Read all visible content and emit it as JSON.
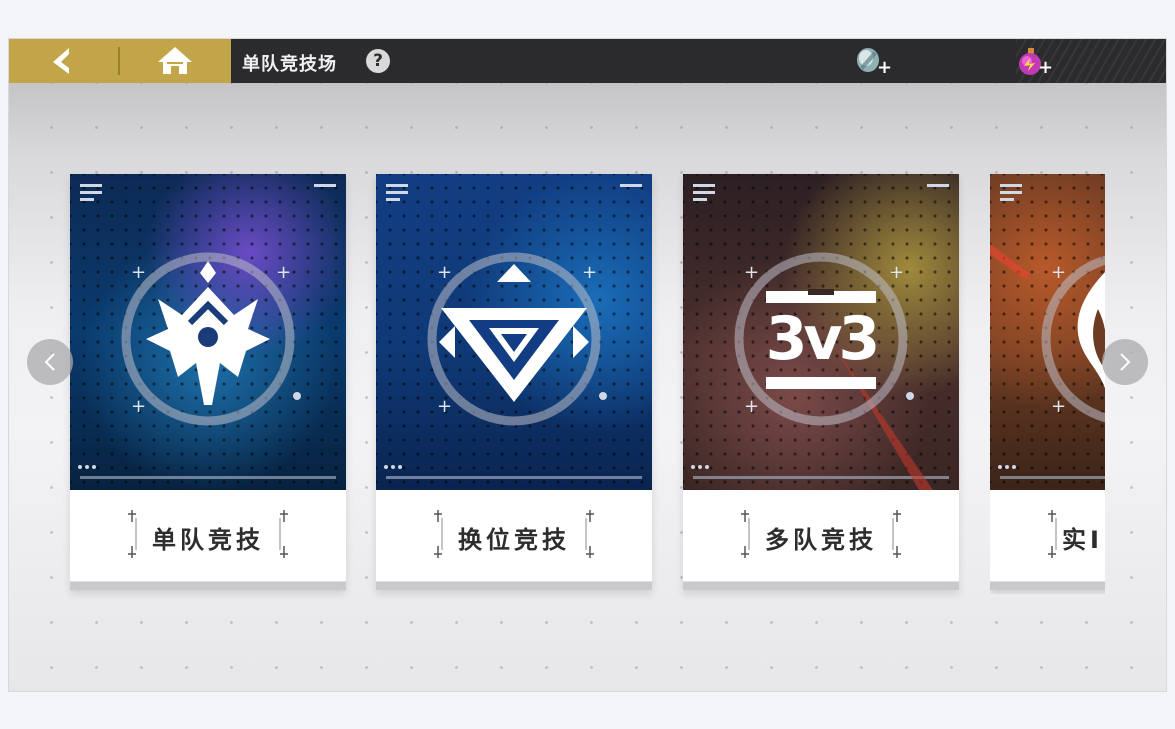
{
  "header": {
    "title": "单队竞技场",
    "help_label": "?",
    "back_icon": "back-arrow-icon",
    "home_icon": "home-icon",
    "currencies": [
      {
        "icon": "silver-gem-icon",
        "plus_label": "+"
      },
      {
        "icon": "purple-potion-icon",
        "plus_label": "+"
      }
    ]
  },
  "modes": [
    {
      "label": "单队竞技",
      "emblem": "crown-emblem-icon",
      "theme": "#0d2a55"
    },
    {
      "label": "换位竞技",
      "emblem": "triangle-emblem-icon",
      "theme": "#103a7a"
    },
    {
      "label": "多队竞技",
      "emblem": "3v3-emblem-icon",
      "emblem_text": "3v3",
      "theme": "#3a2624"
    },
    {
      "label": "实I",
      "emblem": "flame-emblem-icon",
      "theme": "#6b3b23"
    }
  ],
  "navigation": {
    "prev_icon": "chevron-left-icon",
    "next_icon": "chevron-right-icon"
  },
  "colors": {
    "accent_gold": "#c2a549",
    "topbar": "#2b2b2d"
  }
}
